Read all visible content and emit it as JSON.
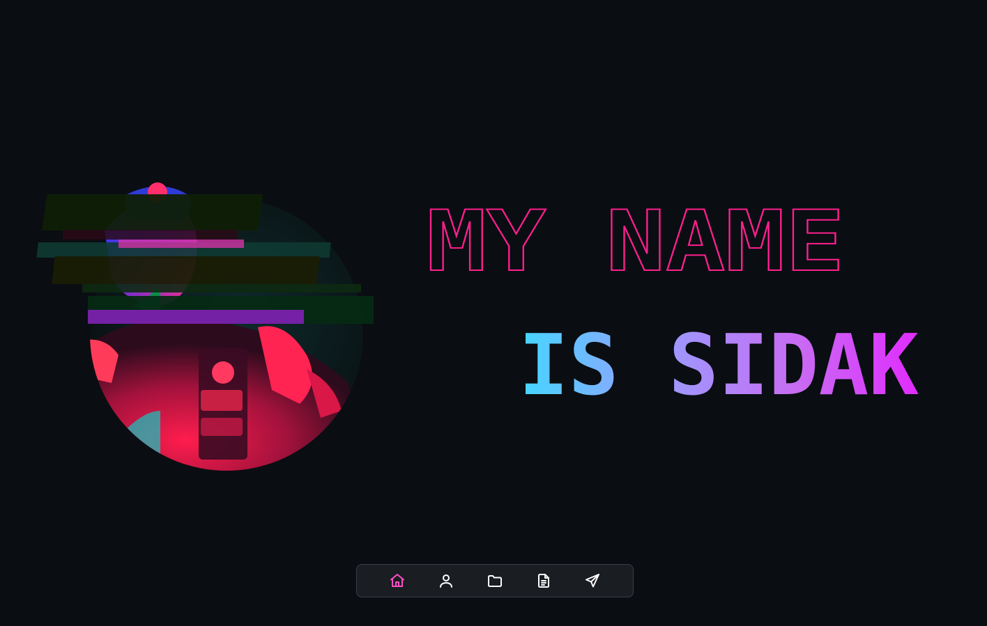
{
  "hero": {
    "line1": "MY NAME",
    "line2": "IS SIDAK",
    "line1_color": "#ff1f8e",
    "line2_gradient": [
      "#44d7ff",
      "#9a9cff",
      "#c86bf2",
      "#e02cff"
    ]
  },
  "portrait": {
    "description_icon": "glitched-portrait-photo",
    "accent_colors": [
      "#ff2a5c",
      "#2a3dff",
      "#1ed36b",
      "#0b3a34"
    ]
  },
  "dock": {
    "items": [
      {
        "icon": "home-icon",
        "active": true
      },
      {
        "icon": "user-icon",
        "active": false
      },
      {
        "icon": "folder-icon",
        "active": false
      },
      {
        "icon": "document-icon",
        "active": false
      },
      {
        "icon": "send-icon",
        "active": false
      }
    ],
    "active_color": "#ff4fc6",
    "icon_color": "#ffffff"
  }
}
